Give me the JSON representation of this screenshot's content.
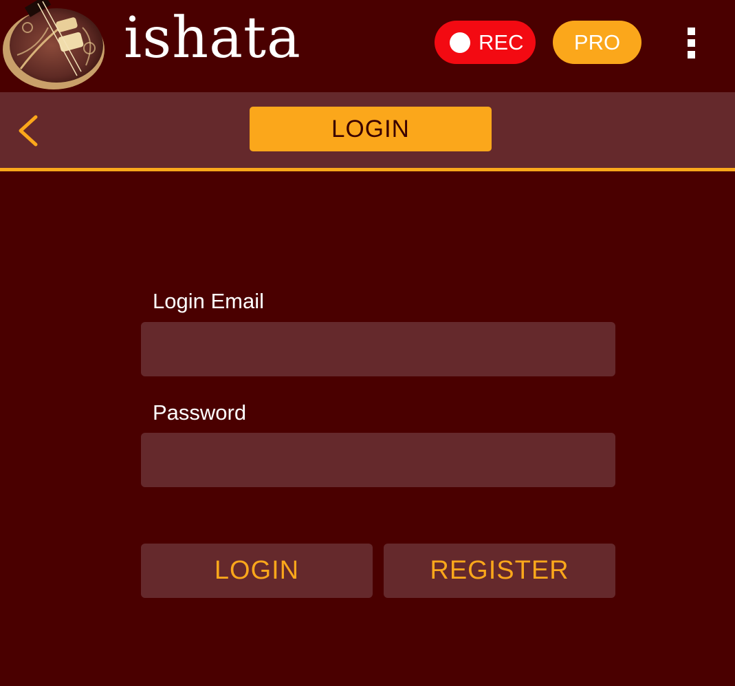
{
  "header": {
    "app_name": "ishata",
    "logo_icon": "sitar-logo-icon",
    "rec_label": "REC",
    "pro_label": "PRO",
    "menu_icon": "more-vertical-icon"
  },
  "titlebar": {
    "back_icon": "chevron-left-icon",
    "title": "LOGIN"
  },
  "form": {
    "email_label": "Login Email",
    "email_value": "",
    "password_label": "Password",
    "password_value": "",
    "login_button": "LOGIN",
    "register_button": "REGISTER"
  },
  "colors": {
    "background": "#4a0000",
    "panel": "#65292c",
    "accent": "#fba71b",
    "record": "#f30a12",
    "text": "#ffffff"
  }
}
